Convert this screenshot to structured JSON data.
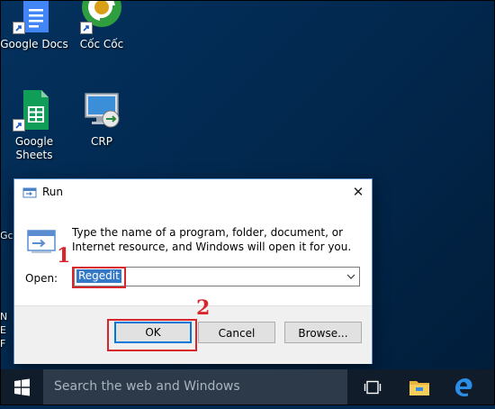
{
  "desktop": {
    "icons": [
      {
        "label": "Google Docs"
      },
      {
        "label": "Cốc Cốc"
      },
      {
        "label": "Google\nSheets"
      },
      {
        "label": "CRP"
      }
    ],
    "partial_left_labels": [
      "Gc",
      "N",
      "E",
      "F"
    ]
  },
  "run_dialog": {
    "title": "Run",
    "description": "Type the name of a program, folder, document, or Internet resource, and Windows will open it for you.",
    "open_label": "Open:",
    "open_value": "Regedit",
    "ok_label": "OK",
    "cancel_label": "Cancel",
    "browse_label": "Browse...",
    "close_glyph": "✕"
  },
  "annotations": {
    "step1": "1",
    "step2": "2",
    "color": "#d9262c"
  },
  "taskbar": {
    "search_placeholder": "Search the web and Windows"
  }
}
